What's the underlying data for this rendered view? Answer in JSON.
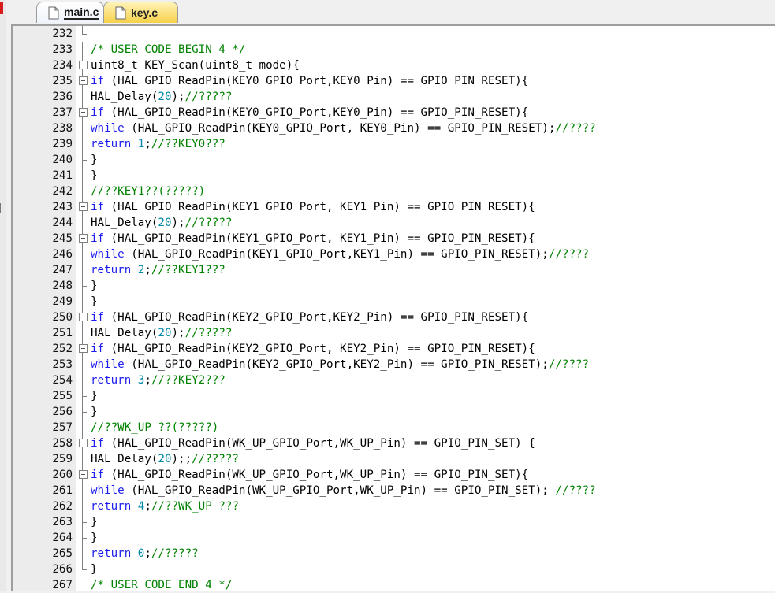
{
  "tabs": [
    {
      "label": "main.c",
      "active": true,
      "icon": "c-file-icon"
    },
    {
      "label": "key.c",
      "active": false,
      "icon": "c-file-icon"
    }
  ],
  "colors": {
    "keyword": "#1d1df0",
    "comment": "#008200",
    "number": "#0088a8",
    "active_tab": "#eef3fb",
    "inactive_tab": "#f7d14a"
  },
  "lines": [
    {
      "n": "232",
      "fold": "end",
      "tokens": []
    },
    {
      "n": "233",
      "fold": "line",
      "tokens": [
        {
          "t": "/* USER CODE BEGIN 4 */",
          "c": "cm"
        }
      ]
    },
    {
      "n": "234",
      "fold": "open",
      "tokens": [
        {
          "t": "uint8_t KEY_Scan(uint8_t mode){",
          "c": ""
        }
      ]
    },
    {
      "n": "235",
      "fold": "open",
      "tokens": [
        {
          "t": "if",
          "c": "kw"
        },
        {
          "t": " (HAL_GPIO_ReadPin(KEY0_GPIO_Port,KEY0_Pin) == GPIO_PIN_RESET){",
          "c": ""
        }
      ]
    },
    {
      "n": "236",
      "fold": "line",
      "tokens": [
        {
          "t": "HAL_Delay(",
          "c": ""
        },
        {
          "t": "20",
          "c": "num"
        },
        {
          "t": ");",
          "c": ""
        },
        {
          "t": "//?????",
          "c": "cm"
        }
      ]
    },
    {
      "n": "237",
      "fold": "open",
      "tokens": [
        {
          "t": "if",
          "c": "kw"
        },
        {
          "t": " (HAL_GPIO_ReadPin(KEY0_GPIO_Port,KEY0_Pin) == GPIO_PIN_RESET){",
          "c": ""
        }
      ]
    },
    {
      "n": "238",
      "fold": "line",
      "tokens": [
        {
          "t": "while",
          "c": "kw"
        },
        {
          "t": " (HAL_GPIO_ReadPin(KEY0_GPIO_Port, KEY0_Pin) == GPIO_PIN_RESET);",
          "c": ""
        },
        {
          "t": "//????",
          "c": "cm"
        }
      ]
    },
    {
      "n": "239",
      "fold": "line",
      "tokens": [
        {
          "t": "return",
          "c": "kw"
        },
        {
          "t": " ",
          "c": ""
        },
        {
          "t": "1",
          "c": "num"
        },
        {
          "t": ";",
          "c": ""
        },
        {
          "t": "//??KEY0???",
          "c": "cm"
        }
      ]
    },
    {
      "n": "240",
      "fold": "close",
      "tokens": [
        {
          "t": "}",
          "c": ""
        }
      ]
    },
    {
      "n": "241",
      "fold": "close",
      "tokens": [
        {
          "t": "}",
          "c": ""
        }
      ]
    },
    {
      "n": "242",
      "fold": "line",
      "tokens": [
        {
          "t": "//??KEY1??(?????)",
          "c": "cm"
        }
      ]
    },
    {
      "n": "243",
      "fold": "open",
      "tokens": [
        {
          "t": "if",
          "c": "kw"
        },
        {
          "t": " (HAL_GPIO_ReadPin(KEY1_GPIO_Port, KEY1_Pin) == GPIO_PIN_RESET){",
          "c": ""
        }
      ]
    },
    {
      "n": "244",
      "fold": "line",
      "tokens": [
        {
          "t": "HAL_Delay(",
          "c": ""
        },
        {
          "t": "20",
          "c": "num"
        },
        {
          "t": ");",
          "c": ""
        },
        {
          "t": "//?????",
          "c": "cm"
        }
      ]
    },
    {
      "n": "245",
      "fold": "open",
      "tokens": [
        {
          "t": "if",
          "c": "kw"
        },
        {
          "t": " (HAL_GPIO_ReadPin(KEY1_GPIO_Port, KEY1_Pin) == GPIO_PIN_RESET){",
          "c": ""
        }
      ]
    },
    {
      "n": "246",
      "fold": "line",
      "tokens": [
        {
          "t": "while",
          "c": "kw"
        },
        {
          "t": " (HAL_GPIO_ReadPin(KEY1_GPIO_Port,KEY1_Pin) == GPIO_PIN_RESET);",
          "c": ""
        },
        {
          "t": "//????",
          "c": "cm"
        }
      ]
    },
    {
      "n": "247",
      "fold": "line",
      "tokens": [
        {
          "t": "return",
          "c": "kw"
        },
        {
          "t": " ",
          "c": ""
        },
        {
          "t": "2",
          "c": "num"
        },
        {
          "t": ";",
          "c": ""
        },
        {
          "t": "//??KEY1???",
          "c": "cm"
        }
      ]
    },
    {
      "n": "248",
      "fold": "close",
      "tokens": [
        {
          "t": "}",
          "c": ""
        }
      ]
    },
    {
      "n": "249",
      "fold": "close",
      "tokens": [
        {
          "t": "}",
          "c": ""
        }
      ]
    },
    {
      "n": "250",
      "fold": "open",
      "tokens": [
        {
          "t": "if",
          "c": "kw"
        },
        {
          "t": " (HAL_GPIO_ReadPin(KEY2_GPIO_Port,KEY2_Pin) == GPIO_PIN_RESET){",
          "c": ""
        }
      ]
    },
    {
      "n": "251",
      "fold": "line",
      "tokens": [
        {
          "t": "HAL_Delay(",
          "c": ""
        },
        {
          "t": "20",
          "c": "num"
        },
        {
          "t": ");",
          "c": ""
        },
        {
          "t": "//?????",
          "c": "cm"
        }
      ]
    },
    {
      "n": "252",
      "fold": "open",
      "tokens": [
        {
          "t": "if",
          "c": "kw"
        },
        {
          "t": " (HAL_GPIO_ReadPin(KEY2_GPIO_Port, KEY2_Pin) == GPIO_PIN_RESET){",
          "c": ""
        }
      ]
    },
    {
      "n": "253",
      "fold": "line",
      "tokens": [
        {
          "t": "while",
          "c": "kw"
        },
        {
          "t": " (HAL_GPIO_ReadPin(KEY2_GPIO_Port,KEY2_Pin) == GPIO_PIN_RESET);",
          "c": ""
        },
        {
          "t": "//????",
          "c": "cm"
        }
      ]
    },
    {
      "n": "254",
      "fold": "line",
      "tokens": [
        {
          "t": "return",
          "c": "kw"
        },
        {
          "t": " ",
          "c": ""
        },
        {
          "t": "3",
          "c": "num"
        },
        {
          "t": ";",
          "c": ""
        },
        {
          "t": "//??KEY2???",
          "c": "cm"
        }
      ]
    },
    {
      "n": "255",
      "fold": "close",
      "tokens": [
        {
          "t": "}",
          "c": ""
        }
      ]
    },
    {
      "n": "256",
      "fold": "close",
      "tokens": [
        {
          "t": "}",
          "c": ""
        }
      ]
    },
    {
      "n": "257",
      "fold": "line",
      "tokens": [
        {
          "t": "//??WK_UP ??(?????)",
          "c": "cm"
        }
      ]
    },
    {
      "n": "258",
      "fold": "open",
      "tokens": [
        {
          "t": "if",
          "c": "kw"
        },
        {
          "t": " (HAL_GPIO_ReadPin(WK_UP_GPIO_Port,WK_UP_Pin) == GPIO_PIN_SET) {",
          "c": ""
        }
      ]
    },
    {
      "n": "259",
      "fold": "line",
      "tokens": [
        {
          "t": "HAL_Delay(",
          "c": ""
        },
        {
          "t": "20",
          "c": "num"
        },
        {
          "t": ");;",
          "c": ""
        },
        {
          "t": "//?????",
          "c": "cm"
        }
      ]
    },
    {
      "n": "260",
      "fold": "open",
      "tokens": [
        {
          "t": "if",
          "c": "kw"
        },
        {
          "t": " (HAL_GPIO_ReadPin(WK_UP_GPIO_Port,WK_UP_Pin) == GPIO_PIN_SET){",
          "c": ""
        }
      ]
    },
    {
      "n": "261",
      "fold": "line",
      "tokens": [
        {
          "t": "while",
          "c": "kw"
        },
        {
          "t": " (HAL_GPIO_ReadPin(WK_UP_GPIO_Port,WK_UP_Pin) == GPIO_PIN_SET); ",
          "c": ""
        },
        {
          "t": "//????",
          "c": "cm"
        }
      ]
    },
    {
      "n": "262",
      "fold": "line",
      "tokens": [
        {
          "t": "return",
          "c": "kw"
        },
        {
          "t": " ",
          "c": ""
        },
        {
          "t": "4",
          "c": "num"
        },
        {
          "t": ";",
          "c": ""
        },
        {
          "t": "//??WK_UP ???",
          "c": "cm"
        }
      ]
    },
    {
      "n": "263",
      "fold": "close",
      "tokens": [
        {
          "t": "}",
          "c": ""
        }
      ]
    },
    {
      "n": "264",
      "fold": "close",
      "tokens": [
        {
          "t": "}",
          "c": ""
        }
      ]
    },
    {
      "n": "265",
      "fold": "line",
      "tokens": [
        {
          "t": "return",
          "c": "kw"
        },
        {
          "t": " ",
          "c": ""
        },
        {
          "t": "0",
          "c": "num"
        },
        {
          "t": ";",
          "c": ""
        },
        {
          "t": "//?????",
          "c": "cm"
        }
      ]
    },
    {
      "n": "266",
      "fold": "end",
      "tokens": [
        {
          "t": "}",
          "c": ""
        }
      ]
    },
    {
      "n": "267",
      "fold": "none",
      "tokens": [
        {
          "t": "/* USER CODE END 4 */",
          "c": "cm"
        }
      ]
    }
  ]
}
